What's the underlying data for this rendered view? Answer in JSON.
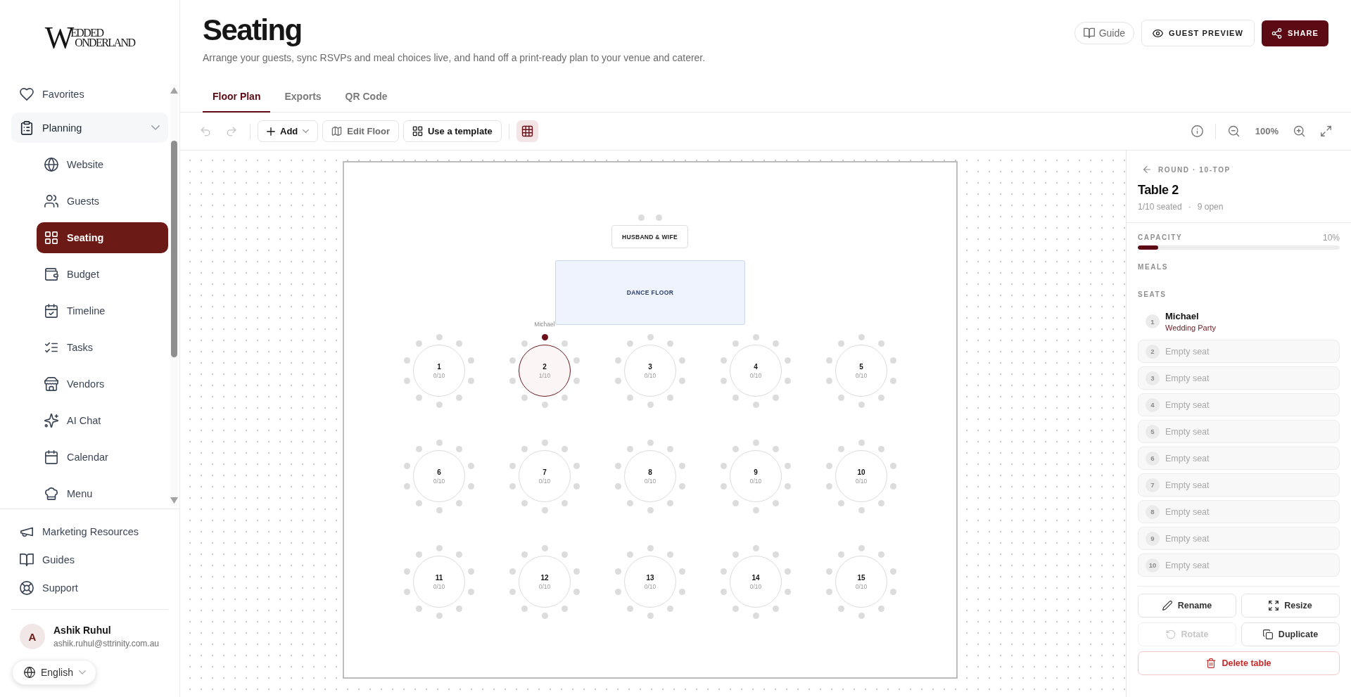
{
  "sidebar": {
    "logo": {
      "initial": "W",
      "lines": [
        "EDDED",
        "ONDERLAND"
      ]
    },
    "nav": [
      {
        "kind": "link",
        "label": "Favorites",
        "selected": false
      },
      {
        "kind": "group",
        "label": "Planning",
        "expanded": true,
        "children": [
          {
            "label": "Website",
            "selected": false
          },
          {
            "label": "Guests",
            "selected": false
          },
          {
            "label": "Seating",
            "selected": true
          },
          {
            "label": "Budget",
            "selected": false
          },
          {
            "label": "Timeline",
            "selected": false
          },
          {
            "label": "Tasks",
            "selected": false
          },
          {
            "label": "Vendors",
            "selected": false
          },
          {
            "label": "AI Chat",
            "selected": false
          },
          {
            "label": "Calendar",
            "selected": false
          },
          {
            "label": "Menu",
            "selected": false
          }
        ]
      }
    ],
    "links": [
      "Marketing Resources",
      "Guides",
      "Support"
    ],
    "user": {
      "initial": "A",
      "name": "Ashik Ruhul",
      "email": "ashik.ruhul@sttrinity.com.au"
    },
    "language": "English"
  },
  "header": {
    "title": "Seating",
    "subtitle": "Arrange your guests, sync RSVPs and meal choices live, and hand off a print-ready plan to your venue and caterer.",
    "actions": [
      {
        "kind": "pill",
        "label": "Guide"
      },
      {
        "kind": "outline",
        "label": "GUEST PREVIEW"
      },
      {
        "kind": "primary",
        "label": "SHARE"
      }
    ]
  },
  "tabs": [
    {
      "label": "Floor Plan",
      "selected": true
    },
    {
      "label": "Exports",
      "selected": false
    },
    {
      "label": "QR Code",
      "selected": false
    }
  ],
  "toolbar": {
    "history": [
      {
        "kind": "undo",
        "disabled": true
      },
      {
        "kind": "redo",
        "disabled": true
      }
    ],
    "tools": [
      {
        "kind": "menu",
        "label": "Add"
      },
      {
        "kind": "toggle",
        "label": "Edit Floor",
        "on": false
      },
      {
        "kind": "action",
        "label": "Use a template"
      }
    ],
    "grid": {
      "on": true
    },
    "zoom": "100%"
  },
  "canvas": {
    "head_table": {
      "label": "HUSBAND & WIFE",
      "seats": [
        {
          "occupied": false
        },
        {
          "occupied": false
        }
      ]
    },
    "dance_floor": {
      "label": "DANCE FLOOR"
    },
    "tables": [
      {
        "number": "1",
        "count": "0/10",
        "selected": false,
        "seats": [
          {
            "occupied": false
          },
          {
            "occupied": false
          },
          {
            "occupied": false
          },
          {
            "occupied": false
          },
          {
            "occupied": false
          },
          {
            "occupied": false
          },
          {
            "occupied": false
          },
          {
            "occupied": false
          },
          {
            "occupied": false
          },
          {
            "occupied": false
          }
        ]
      },
      {
        "number": "2",
        "count": "1/10",
        "selected": true,
        "seats": [
          {
            "occupied": true,
            "guest": "Michael"
          },
          {
            "occupied": false
          },
          {
            "occupied": false
          },
          {
            "occupied": false
          },
          {
            "occupied": false
          },
          {
            "occupied": false
          },
          {
            "occupied": false
          },
          {
            "occupied": false
          },
          {
            "occupied": false
          },
          {
            "occupied": false
          }
        ]
      },
      {
        "number": "3",
        "count": "0/10",
        "selected": false,
        "seats": [
          {
            "occupied": false
          },
          {
            "occupied": false
          },
          {
            "occupied": false
          },
          {
            "occupied": false
          },
          {
            "occupied": false
          },
          {
            "occupied": false
          },
          {
            "occupied": false
          },
          {
            "occupied": false
          },
          {
            "occupied": false
          },
          {
            "occupied": false
          }
        ]
      },
      {
        "number": "4",
        "count": "0/10",
        "selected": false,
        "seats": [
          {
            "occupied": false
          },
          {
            "occupied": false
          },
          {
            "occupied": false
          },
          {
            "occupied": false
          },
          {
            "occupied": false
          },
          {
            "occupied": false
          },
          {
            "occupied": false
          },
          {
            "occupied": false
          },
          {
            "occupied": false
          },
          {
            "occupied": false
          }
        ]
      },
      {
        "number": "5",
        "count": "0/10",
        "selected": false,
        "seats": [
          {
            "occupied": false
          },
          {
            "occupied": false
          },
          {
            "occupied": false
          },
          {
            "occupied": false
          },
          {
            "occupied": false
          },
          {
            "occupied": false
          },
          {
            "occupied": false
          },
          {
            "occupied": false
          },
          {
            "occupied": false
          },
          {
            "occupied": false
          }
        ]
      },
      {
        "number": "6",
        "count": "0/10",
        "selected": false,
        "seats": [
          {
            "occupied": false
          },
          {
            "occupied": false
          },
          {
            "occupied": false
          },
          {
            "occupied": false
          },
          {
            "occupied": false
          },
          {
            "occupied": false
          },
          {
            "occupied": false
          },
          {
            "occupied": false
          },
          {
            "occupied": false
          },
          {
            "occupied": false
          }
        ]
      },
      {
        "number": "7",
        "count": "0/10",
        "selected": false,
        "seats": [
          {
            "occupied": false
          },
          {
            "occupied": false
          },
          {
            "occupied": false
          },
          {
            "occupied": false
          },
          {
            "occupied": false
          },
          {
            "occupied": false
          },
          {
            "occupied": false
          },
          {
            "occupied": false
          },
          {
            "occupied": false
          },
          {
            "occupied": false
          }
        ]
      },
      {
        "number": "8",
        "count": "0/10",
        "selected": false,
        "seats": [
          {
            "occupied": false
          },
          {
            "occupied": false
          },
          {
            "occupied": false
          },
          {
            "occupied": false
          },
          {
            "occupied": false
          },
          {
            "occupied": false
          },
          {
            "occupied": false
          },
          {
            "occupied": false
          },
          {
            "occupied": false
          },
          {
            "occupied": false
          }
        ]
      },
      {
        "number": "9",
        "count": "0/10",
        "selected": false,
        "seats": [
          {
            "occupied": false
          },
          {
            "occupied": false
          },
          {
            "occupied": false
          },
          {
            "occupied": false
          },
          {
            "occupied": false
          },
          {
            "occupied": false
          },
          {
            "occupied": false
          },
          {
            "occupied": false
          },
          {
            "occupied": false
          },
          {
            "occupied": false
          }
        ]
      },
      {
        "number": "10",
        "count": "0/10",
        "selected": false,
        "seats": [
          {
            "occupied": false
          },
          {
            "occupied": false
          },
          {
            "occupied": false
          },
          {
            "occupied": false
          },
          {
            "occupied": false
          },
          {
            "occupied": false
          },
          {
            "occupied": false
          },
          {
            "occupied": false
          },
          {
            "occupied": false
          },
          {
            "occupied": false
          }
        ]
      },
      {
        "number": "11",
        "count": "0/10",
        "selected": false,
        "seats": [
          {
            "occupied": false
          },
          {
            "occupied": false
          },
          {
            "occupied": false
          },
          {
            "occupied": false
          },
          {
            "occupied": false
          },
          {
            "occupied": false
          },
          {
            "occupied": false
          },
          {
            "occupied": false
          },
          {
            "occupied": false
          },
          {
            "occupied": false
          }
        ]
      },
      {
        "number": "12",
        "count": "0/10",
        "selected": false,
        "seats": [
          {
            "occupied": false
          },
          {
            "occupied": false
          },
          {
            "occupied": false
          },
          {
            "occupied": false
          },
          {
            "occupied": false
          },
          {
            "occupied": false
          },
          {
            "occupied": false
          },
          {
            "occupied": false
          },
          {
            "occupied": false
          },
          {
            "occupied": false
          }
        ]
      },
      {
        "number": "13",
        "count": "0/10",
        "selected": false,
        "seats": [
          {
            "occupied": false
          },
          {
            "occupied": false
          },
          {
            "occupied": false
          },
          {
            "occupied": false
          },
          {
            "occupied": false
          },
          {
            "occupied": false
          },
          {
            "occupied": false
          },
          {
            "occupied": false
          },
          {
            "occupied": false
          },
          {
            "occupied": false
          }
        ]
      },
      {
        "number": "14",
        "count": "0/10",
        "selected": false,
        "seats": [
          {
            "occupied": false
          },
          {
            "occupied": false
          },
          {
            "occupied": false
          },
          {
            "occupied": false
          },
          {
            "occupied": false
          },
          {
            "occupied": false
          },
          {
            "occupied": false
          },
          {
            "occupied": false
          },
          {
            "occupied": false
          },
          {
            "occupied": false
          }
        ]
      },
      {
        "number": "15",
        "count": "0/10",
        "selected": false,
        "seats": [
          {
            "occupied": false
          },
          {
            "occupied": false
          },
          {
            "occupied": false
          },
          {
            "occupied": false
          },
          {
            "occupied": false
          },
          {
            "occupied": false
          },
          {
            "occupied": false
          },
          {
            "occupied": false
          },
          {
            "occupied": false
          },
          {
            "occupied": false
          }
        ]
      }
    ]
  },
  "details": {
    "type": "ROUND · 10-TOP",
    "title": "Table 2",
    "summary": [
      "1/10 seated",
      "·",
      "9 open"
    ],
    "capacity": {
      "label": "CAPACITY",
      "reading": "10%",
      "level": 0.1
    },
    "meals_label": "MEALS",
    "seats_label": "SEATS",
    "seats": [
      {
        "number": "1",
        "occupied": true,
        "name": "Michael",
        "group": "Wedding Party"
      },
      {
        "number": "2",
        "occupied": false,
        "label": "Empty seat"
      },
      {
        "number": "3",
        "occupied": false,
        "label": "Empty seat"
      },
      {
        "number": "4",
        "occupied": false,
        "label": "Empty seat"
      },
      {
        "number": "5",
        "occupied": false,
        "label": "Empty seat"
      },
      {
        "number": "6",
        "occupied": false,
        "label": "Empty seat"
      },
      {
        "number": "7",
        "occupied": false,
        "label": "Empty seat"
      },
      {
        "number": "8",
        "occupied": false,
        "label": "Empty seat"
      },
      {
        "number": "9",
        "occupied": false,
        "label": "Empty seat"
      },
      {
        "number": "10",
        "occupied": false,
        "label": "Empty seat"
      }
    ],
    "actions": [
      {
        "kind": "default",
        "label": "Rename",
        "disabled": false
      },
      {
        "kind": "default",
        "label": "Resize",
        "disabled": false
      },
      {
        "kind": "default",
        "label": "Rotate",
        "disabled": true
      },
      {
        "kind": "default",
        "label": "Duplicate",
        "disabled": false
      },
      {
        "kind": "danger",
        "label": "Delete table",
        "disabled": false
      }
    ]
  }
}
